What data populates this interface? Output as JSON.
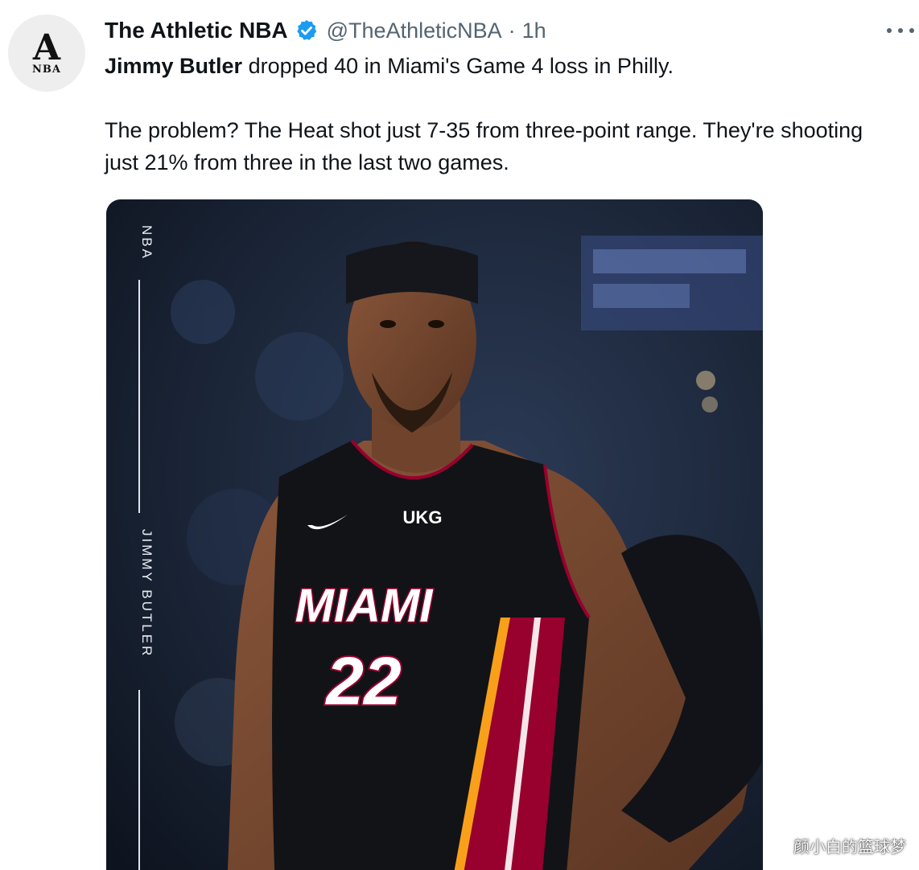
{
  "account": {
    "avatar_logo": "A",
    "avatar_sub": "NBA",
    "display_name": "The Athletic NBA",
    "handle": "@TheAthleticNBA",
    "separator": "·",
    "time": "1h",
    "verified_icon": "verified-badge-icon",
    "verified_color": "#1d9bf0"
  },
  "tweet": {
    "bold_name": "Jimmy Butler",
    "line1_rest": " dropped 40 in Miami's Game 4 loss in Philly.",
    "line2": "The problem? The Heat shot just 7-35 from three-point range. They're shooting just 21% from three in the last two games."
  },
  "media": {
    "side_label_top": "NBA",
    "side_label_name": "JIMMY BUTLER",
    "jersey_team": "MIAMI",
    "jersey_number": "22",
    "jersey_sponsor": "UKG"
  },
  "watermark": "颜小白的篮球梦",
  "icons": {
    "more": "more-options-icon"
  },
  "colors": {
    "text": "#0f1419",
    "secondary": "#536471",
    "jersey_red": "#98002e"
  }
}
